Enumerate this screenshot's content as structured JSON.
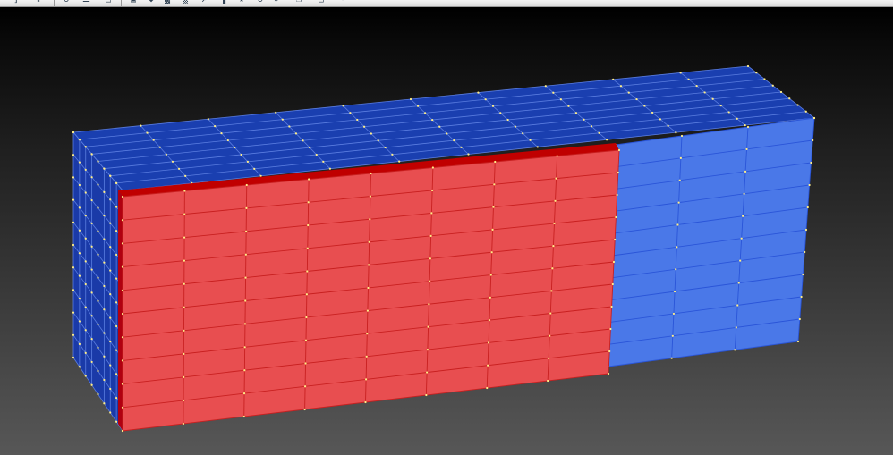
{
  "toolbar": {
    "buttons": [
      {
        "name": "zoom-fit-button",
        "glyph": "]"
      },
      {
        "name": "zoom-window-button",
        "glyph": "↙"
      },
      {
        "name": "rotate-view-button",
        "glyph": "↻"
      },
      {
        "name": "pan-view-button",
        "glyph": "☰"
      },
      {
        "name": "save-view-button",
        "glyph": "□"
      },
      {
        "name": "shade-toggle-button",
        "glyph": "▣"
      },
      {
        "name": "mesh-display-button",
        "glyph": "◆"
      },
      {
        "name": "element-select-button",
        "glyph": "▓"
      },
      {
        "name": "node-select-button",
        "glyph": "▒"
      },
      {
        "name": "measure-button",
        "glyph": "↗"
      },
      {
        "name": "chart-button",
        "glyph": "▐"
      },
      {
        "name": "highlight-button",
        "glyph": "★"
      },
      {
        "name": "reset-button",
        "glyph": "↺"
      },
      {
        "name": "filter-button",
        "glyph": "»"
      },
      {
        "name": "copy-button",
        "glyph": "❐"
      },
      {
        "name": "paste-button",
        "glyph": "❑"
      },
      {
        "name": "undo-button",
        "glyph": "↶"
      }
    ]
  },
  "model": {
    "blue_part": {
      "top_color": "#1a3fb0",
      "side_color": "#1a3aa8",
      "front_color": "#4a78e8"
    },
    "red_part": {
      "front_color": "#e84e50",
      "top_color": "#c00000",
      "side_color": "#b00010"
    },
    "node_color": "#ffee88",
    "mesh": {
      "front_columns": 8,
      "front_rows": 10,
      "depth_layers": 8
    }
  }
}
